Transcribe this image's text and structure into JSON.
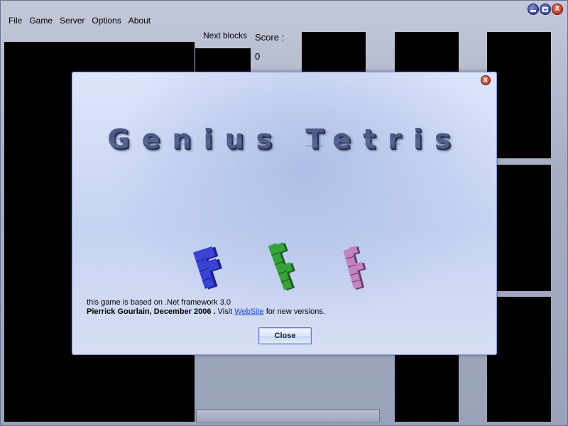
{
  "menu": {
    "items": [
      {
        "label": "File"
      },
      {
        "label": "Game"
      },
      {
        "label": "Server"
      },
      {
        "label": "Options"
      },
      {
        "label": "About"
      }
    ]
  },
  "game": {
    "next_blocks_label": "Next blocks",
    "score_label": "Score :",
    "score_value": "0"
  },
  "dialog": {
    "title": "Genius Tetris",
    "info_line_1": "this game is based on .Net framework 3.0",
    "author": "Pierrick Gourlain, December 2006 .",
    "visit_text": " Visit ",
    "link_text": "WebSite",
    "after_link": " for new versions.",
    "close_label": "Close",
    "close_x": "X"
  },
  "window": {
    "close_glyph": "X"
  },
  "icons": {
    "minimize": "minimize-icon",
    "maximize": "maximize-icon",
    "close": "close-icon",
    "pieces": [
      "blue-tetris-piece-icon",
      "green-tetris-piece-icon",
      "pink-tetris-piece-icon"
    ]
  },
  "colors": {
    "piece_blue": "#2e35b8",
    "piece_green": "#2f8a33",
    "piece_pink": "#b06fb0",
    "board": "#000000",
    "link": "#1d3fd6"
  }
}
